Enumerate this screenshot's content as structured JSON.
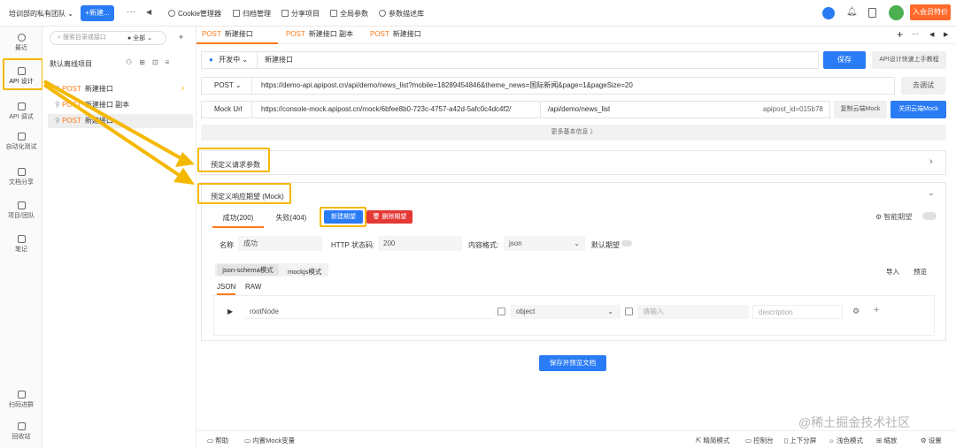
{
  "topbar": {
    "team_name": "培训部的私有团队",
    "new_button": "+新建...",
    "nav": [
      "Cookie管理器",
      "归档管理",
      "分享项目",
      "全局参数",
      "参数描述库"
    ],
    "vip_button": "入会员特价"
  },
  "rail": {
    "items": [
      "最近",
      "API 设计",
      "API 调试",
      "自动化测试",
      "文档分享",
      "项目/团队",
      "笔记",
      "扫码进群",
      "回收站"
    ]
  },
  "tree": {
    "search_placeholder": "搜索目录或接口",
    "filter": "全部",
    "project": "默认离线项目",
    "method": "POST",
    "items": [
      "新建接口",
      "新建接口 副本",
      "新建接口"
    ]
  },
  "tabs": [
    {
      "method": "POST",
      "name": "新建接口"
    },
    {
      "method": "POST",
      "name": "新建接口 副本"
    },
    {
      "method": "POST",
      "name": "新建接口"
    }
  ],
  "api": {
    "status": "开发中",
    "name": "新建接口",
    "save": "保存",
    "tutorial": "API设计快速上手教程",
    "method": "POST",
    "url": "https://demo-api.apipost.cn/api/demo/news_list?mobile=18289454846&theme_news=国际新闻&page=1&pageSize=20",
    "debug": "去调试",
    "mock_label": "Mock Url",
    "mock_base": "https://console-mock.apipost.cn/mock/6bfee8b0-723c-4757-a42d-5afc0c4dc4f2/",
    "mock_path": "/api/demo/news_list",
    "mock_id": "apipost_id=015b78",
    "copy_mock": "复制云端Mock",
    "close_mock": "关闭云端Mock",
    "more_info": "更多基本信息 〉"
  },
  "request_section": {
    "title": "预定义请求参数"
  },
  "response_section": {
    "title": "预定义响应期望 (Mock)",
    "tab_success": "成功(200)",
    "tab_fail": "失败(404)",
    "new_expect": "新建期望",
    "delete_expect": "删除期望",
    "smart_expect": "智能期望",
    "name_label": "名称",
    "name_value": "成功",
    "http_label": "HTTP 状态码:",
    "http_value": "200",
    "content_label": "内容格式:",
    "content_value": "json",
    "default_label": "默认期望",
    "mode_tabs": [
      "json-schema模式",
      "mockjs模式"
    ],
    "import": "导入",
    "preview": "预览",
    "sub_tabs": [
      "JSON",
      "RAW"
    ],
    "row": {
      "node": "rootNode",
      "type": "object",
      "placeholder": "请输入",
      "description": "description"
    },
    "save_preview": "保存并预览文档"
  },
  "bottom": {
    "left": [
      "帮助",
      "内置Mock变量"
    ],
    "right": [
      "精简模式",
      "控制台",
      "上下分屏",
      "浅色模式",
      "缩放",
      "设置"
    ]
  },
  "watermark": "@稀土掘金技术社区",
  "colors": {
    "primary": "#2a7bf6",
    "accent": "#ff7a1a",
    "highlight": "#f5b800",
    "danger": "#e53935"
  }
}
